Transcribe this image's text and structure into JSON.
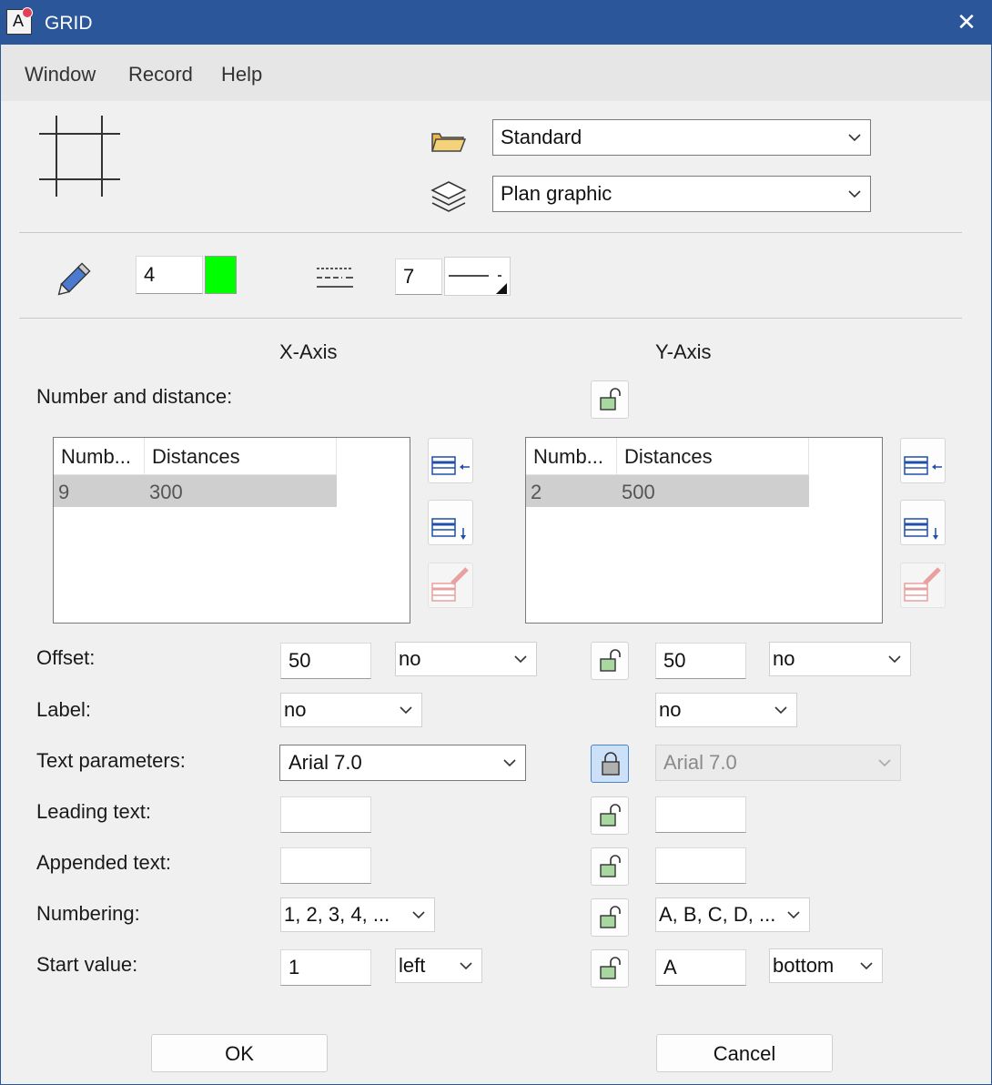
{
  "window": {
    "title": "GRID",
    "close_glyph": "✕"
  },
  "menu": {
    "items": [
      "Window",
      "Record",
      "Help"
    ]
  },
  "top": {
    "folder_select": "Standard",
    "layer_select": "Plan graphic",
    "pen_value": "4",
    "pen_color": "#00ff00",
    "line_value": "7"
  },
  "headers": {
    "x_axis": "X-Axis",
    "y_axis": "Y-Axis"
  },
  "labels": {
    "number_distance": "Number and distance:",
    "offset": "Offset:",
    "label": "Label:",
    "text_parameters": "Text parameters:",
    "leading_text": "Leading text:",
    "appended_text": "Appended text:",
    "numbering": "Numbering:",
    "start_value": "Start value:"
  },
  "x_table": {
    "columns": [
      "Numb...",
      "Distances"
    ],
    "rows": [
      [
        "9",
        "300"
      ]
    ]
  },
  "y_table": {
    "columns": [
      "Numb...",
      "Distances"
    ],
    "rows": [
      [
        "2",
        "500"
      ]
    ]
  },
  "x": {
    "offset": "50",
    "offset_mode": "no",
    "label": "no",
    "text_params": "Arial 7.0",
    "leading": "",
    "appended": "",
    "numbering": "1, 2, 3, 4, ...",
    "start": "1",
    "start_pos": "left"
  },
  "y": {
    "offset": "50",
    "offset_mode": "no",
    "label": "no",
    "text_params": "Arial 7.0",
    "leading": "",
    "appended": "",
    "numbering": "A, B, C, D, ...",
    "start": "A",
    "start_pos": "bottom"
  },
  "buttons": {
    "ok": "OK",
    "cancel": "Cancel"
  },
  "icons": [
    "grid-icon",
    "folder-icon",
    "layers-icon",
    "pencil-icon",
    "line-style-icon",
    "unlock-icon",
    "lock-icon",
    "table-insert-icon",
    "table-append-icon",
    "table-delete-icon",
    "chevron-down-icon",
    "close-icon"
  ]
}
